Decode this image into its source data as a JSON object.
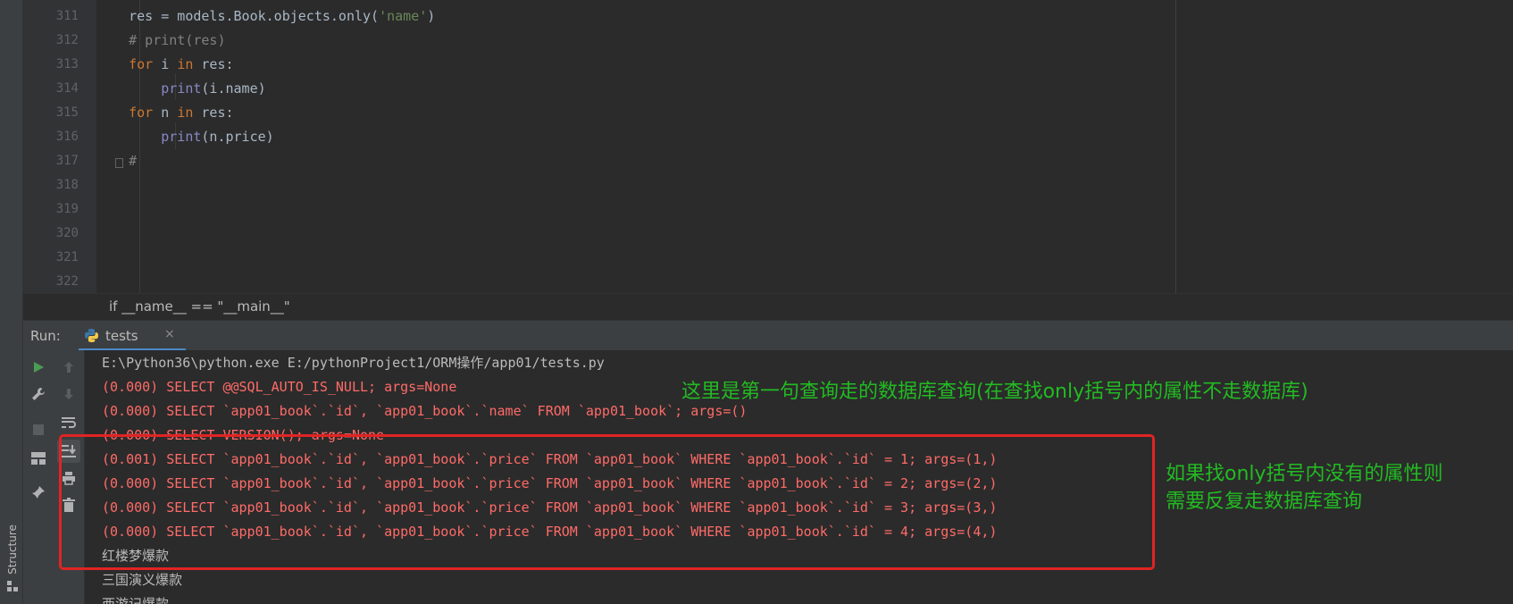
{
  "structure_tab": {
    "label": "Structure"
  },
  "editor": {
    "lines": [
      {
        "num": "311",
        "code": "    res = models.Book.objects.only('name')"
      },
      {
        "num": "312",
        "code": "    # print(res)"
      },
      {
        "num": "313",
        "code": "    for i in res:"
      },
      {
        "num": "314",
        "code": "        print(i.name)"
      },
      {
        "num": "315",
        "code": "    for n in res:"
      },
      {
        "num": "316",
        "code": "        print(n.price)"
      },
      {
        "num": "317",
        "code": "    #"
      },
      {
        "num": "318",
        "code": ""
      },
      {
        "num": "319",
        "code": ""
      },
      {
        "num": "320",
        "code": ""
      },
      {
        "num": "321",
        "code": ""
      },
      {
        "num": "322",
        "code": ""
      }
    ]
  },
  "breadcrumb": {
    "text": "if __name__ == \"__main__\""
  },
  "run_panel": {
    "label": "Run:",
    "tab_name": "tests",
    "tab_close": "×"
  },
  "console": {
    "lines": [
      {
        "text": "E:\\Python36\\python.exe E:/pythonProject1/ORM操作/app01/tests.py",
        "style": "gray"
      },
      {
        "text": "(0.000) SELECT @@SQL_AUTO_IS_NULL; args=None",
        "style": "red"
      },
      {
        "text": "(0.000) SELECT `app01_book`.`id`, `app01_book`.`name` FROM `app01_book`; args=()",
        "style": "red"
      },
      {
        "text": "(0.000) SELECT VERSION(); args=None",
        "style": "red"
      },
      {
        "text": "(0.001) SELECT `app01_book`.`id`, `app01_book`.`price` FROM `app01_book` WHERE `app01_book`.`id` = 1; args=(1,)",
        "style": "red"
      },
      {
        "text": "(0.000) SELECT `app01_book`.`id`, `app01_book`.`price` FROM `app01_book` WHERE `app01_book`.`id` = 2; args=(2,)",
        "style": "red"
      },
      {
        "text": "(0.000) SELECT `app01_book`.`id`, `app01_book`.`price` FROM `app01_book` WHERE `app01_book`.`id` = 3; args=(3,)",
        "style": "red"
      },
      {
        "text": "(0.000) SELECT `app01_book`.`id`, `app01_book`.`price` FROM `app01_book` WHERE `app01_book`.`id` = 4; args=(4,)",
        "style": "red"
      },
      {
        "text": "红楼梦爆款",
        "style": "gray"
      },
      {
        "text": "三国演义爆款",
        "style": "gray"
      },
      {
        "text": "西游记爆款",
        "style": "gray"
      }
    ]
  },
  "annotations": {
    "first": "这里是第一句查询走的数据库查询(在查找only括号内的属性不走数据库)",
    "second_line1": "如果找only括号内没有的属性则",
    "second_line2": "需要反复走数据库查询"
  },
  "colors": {
    "background": "#2b2b2b",
    "panel": "#3c3f41",
    "console_error": "#ff6b68",
    "annotation_green": "#22bb22",
    "annotation_red": "#e02424",
    "tab_underline": "#4a88c7"
  },
  "icons": {
    "toolbar_1": [
      "run-icon",
      "wrench-icon",
      "stop-icon",
      "layout-icon",
      "pin-icon"
    ],
    "toolbar_2": [
      "arrow-up-icon",
      "arrow-down-icon",
      "soft-wrap-icon",
      "scroll-to-end-icon",
      "print-icon",
      "trash-icon"
    ]
  }
}
